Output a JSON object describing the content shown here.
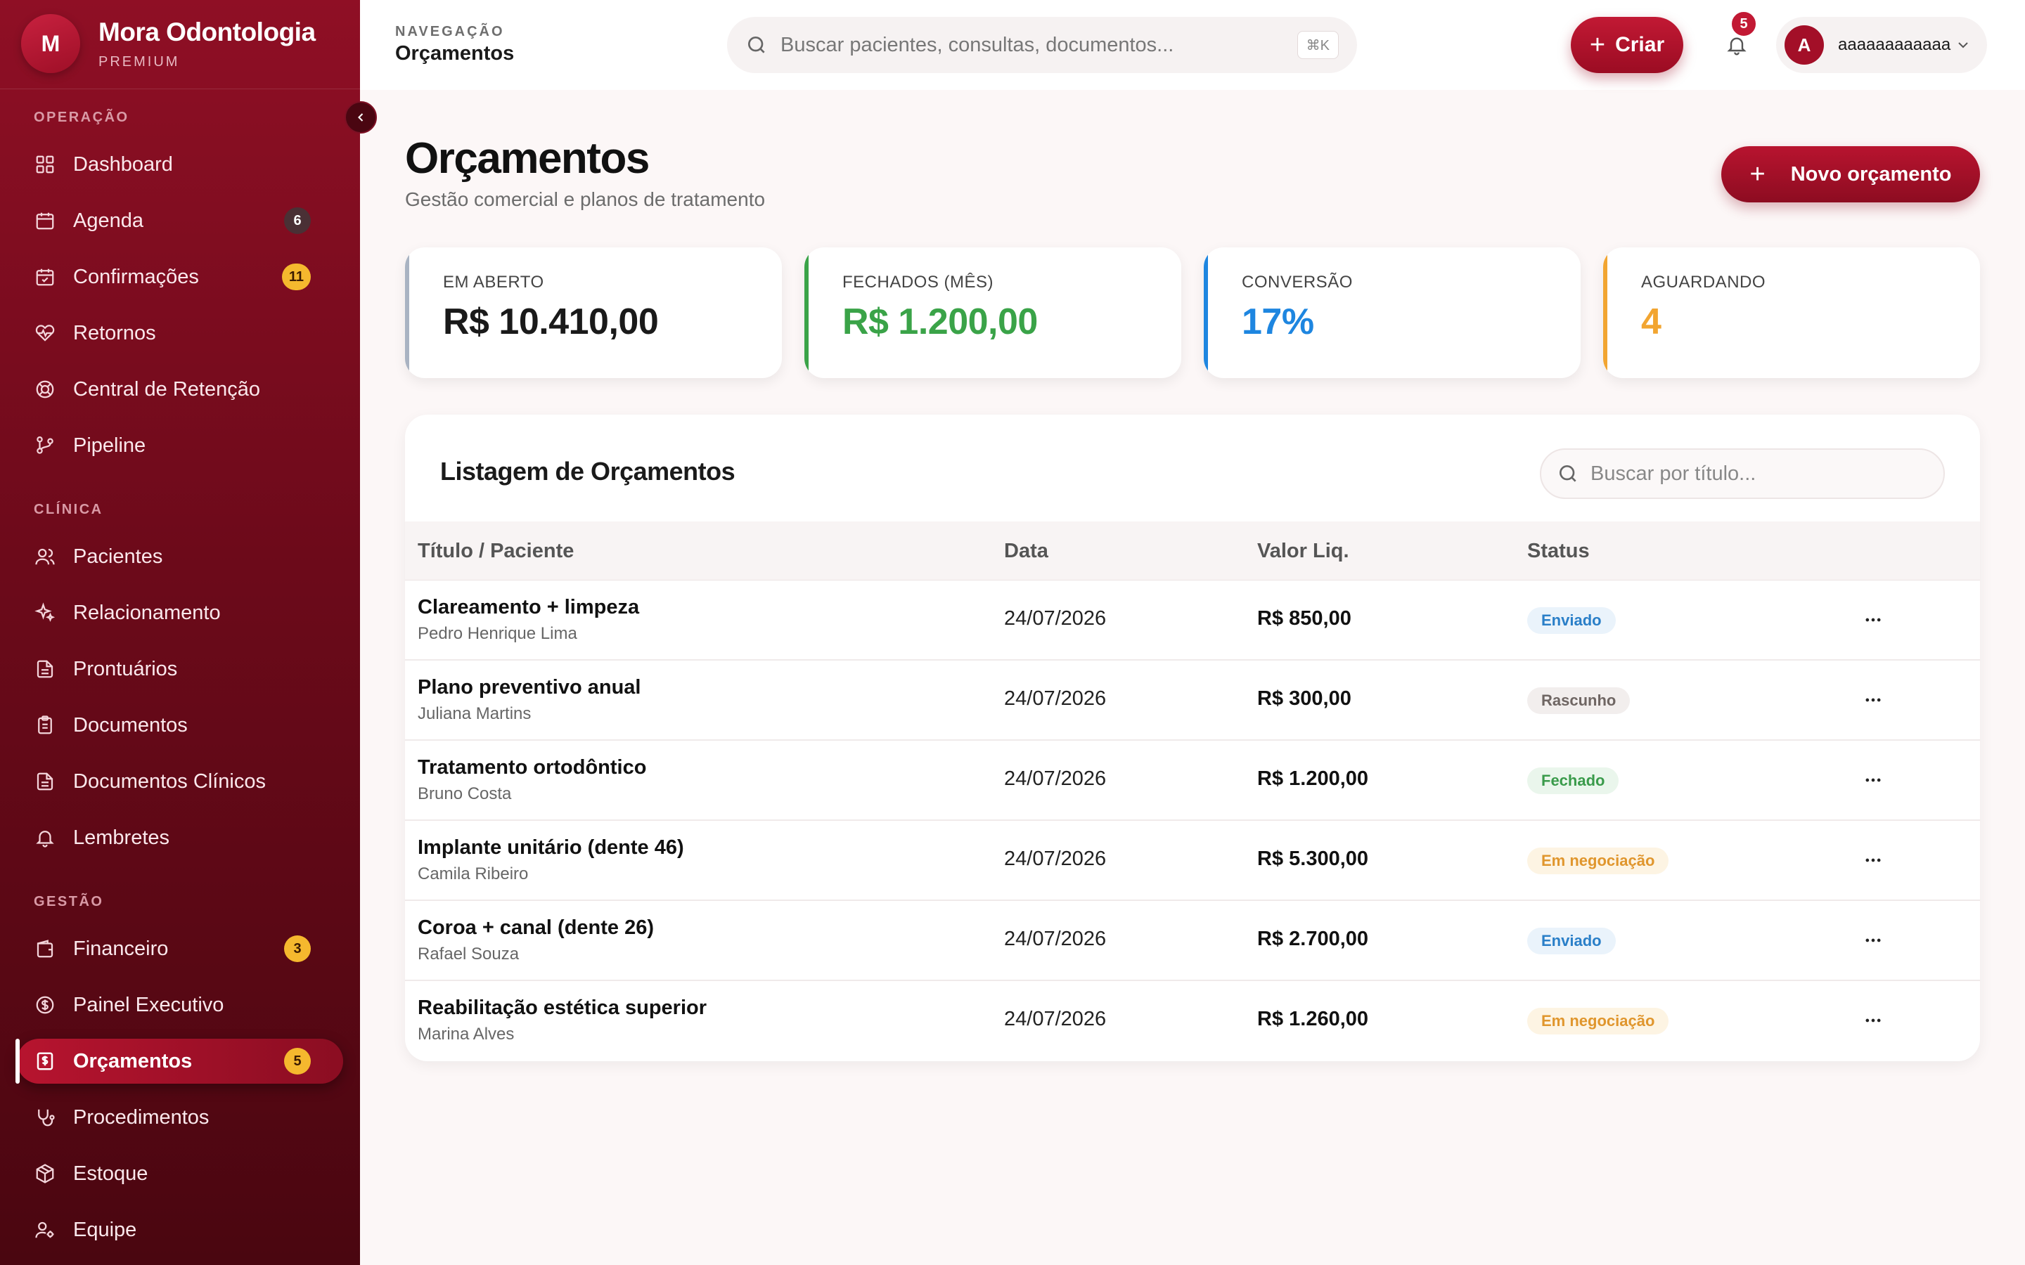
{
  "brand": {
    "initial": "M",
    "name": "Mora Odontologia",
    "tier": "PREMIUM"
  },
  "sidebar": {
    "sections": [
      {
        "label": "OPERAÇÃO",
        "items": [
          {
            "label": "Dashboard",
            "icon": "grid-icon"
          },
          {
            "label": "Agenda",
            "icon": "calendar-icon",
            "badge": "6"
          },
          {
            "label": "Confirmações",
            "icon": "calendar-check-icon",
            "badge": "11"
          },
          {
            "label": "Retornos",
            "icon": "heart-pulse-icon"
          },
          {
            "label": "Central de Retenção",
            "icon": "lifebuoy-icon"
          },
          {
            "label": "Pipeline",
            "icon": "git-branch-icon"
          }
        ]
      },
      {
        "label": "CLÍNICA",
        "items": [
          {
            "label": "Pacientes",
            "icon": "users-icon"
          },
          {
            "label": "Relacionamento",
            "icon": "sparkles-icon"
          },
          {
            "label": "Prontuários",
            "icon": "file-text-icon"
          },
          {
            "label": "Documentos",
            "icon": "clipboard-icon"
          },
          {
            "label": "Documentos Clínicos",
            "icon": "file-text-icon"
          },
          {
            "label": "Lembretes",
            "icon": "bell-icon"
          }
        ]
      },
      {
        "label": "GESTÃO",
        "items": [
          {
            "label": "Financeiro",
            "icon": "wallet-icon",
            "badge": "3"
          },
          {
            "label": "Painel Executivo",
            "icon": "dollar-circle-icon"
          },
          {
            "label": "Orçamentos",
            "icon": "receipt-icon",
            "badge": "5",
            "active": true
          },
          {
            "label": "Procedimentos",
            "icon": "stethoscope-icon"
          },
          {
            "label": "Estoque",
            "icon": "package-icon"
          },
          {
            "label": "Equipe",
            "icon": "user-cog-icon"
          }
        ]
      }
    ]
  },
  "topbar": {
    "crumb_label": "NAVEGAÇÃO",
    "crumb_page": "Orçamentos",
    "search_placeholder": "Buscar pacientes, consultas, documentos...",
    "search_shortcut": "⌘K",
    "create_label": "Criar",
    "notifications_count": "5",
    "user_initial": "A",
    "user_name": "aaaaaaaaaaaa"
  },
  "main": {
    "title": "Orçamentos",
    "subtitle": "Gestão comercial e planos de tratamento",
    "new_button": "Novo orçamento",
    "kpis": [
      {
        "label": "EM ABERTO",
        "value": "R$ 10.410,00",
        "color": "#1a1a1a",
        "accent": "#a9b3c2"
      },
      {
        "label": "FECHADOS (MÊS)",
        "value": "R$ 1.200,00",
        "color": "#3aa348",
        "accent": "#3aa348"
      },
      {
        "label": "CONVERSÃO",
        "value": "17%",
        "color": "#1e86e0",
        "accent": "#1e86e0"
      },
      {
        "label": "AGUARDANDO",
        "value": "4",
        "color": "#f2a531",
        "accent": "#f2a531"
      }
    ],
    "list": {
      "title": "Listagem de Orçamentos",
      "search_placeholder": "Buscar por título...",
      "columns": [
        "Título / Paciente",
        "Data",
        "Valor Liq.",
        "Status"
      ],
      "rows": [
        {
          "title": "Clareamento + limpeza",
          "patient": "Pedro Henrique Lima",
          "date": "24/07/2026",
          "value": "R$ 850,00",
          "status": "Enviado",
          "status_kind": "enviado"
        },
        {
          "title": "Plano preventivo anual",
          "patient": "Juliana Martins",
          "date": "24/07/2026",
          "value": "R$ 300,00",
          "status": "Rascunho",
          "status_kind": "rascunho"
        },
        {
          "title": "Tratamento ortodôntico",
          "patient": "Bruno Costa",
          "date": "24/07/2026",
          "value": "R$ 1.200,00",
          "status": "Fechado",
          "status_kind": "fechado"
        },
        {
          "title": "Implante unitário (dente 46)",
          "patient": "Camila Ribeiro",
          "date": "24/07/2026",
          "value": "R$ 5.300,00",
          "status": "Em negociação",
          "status_kind": "negociacao"
        },
        {
          "title": "Coroa + canal (dente 26)",
          "patient": "Rafael Souza",
          "date": "24/07/2026",
          "value": "R$ 2.700,00",
          "status": "Enviado",
          "status_kind": "enviado"
        },
        {
          "title": "Reabilitação estética superior",
          "patient": "Marina Alves",
          "date": "24/07/2026",
          "value": "R$ 1.260,00",
          "status": "Em negociação",
          "status_kind": "negociacao"
        }
      ]
    }
  }
}
